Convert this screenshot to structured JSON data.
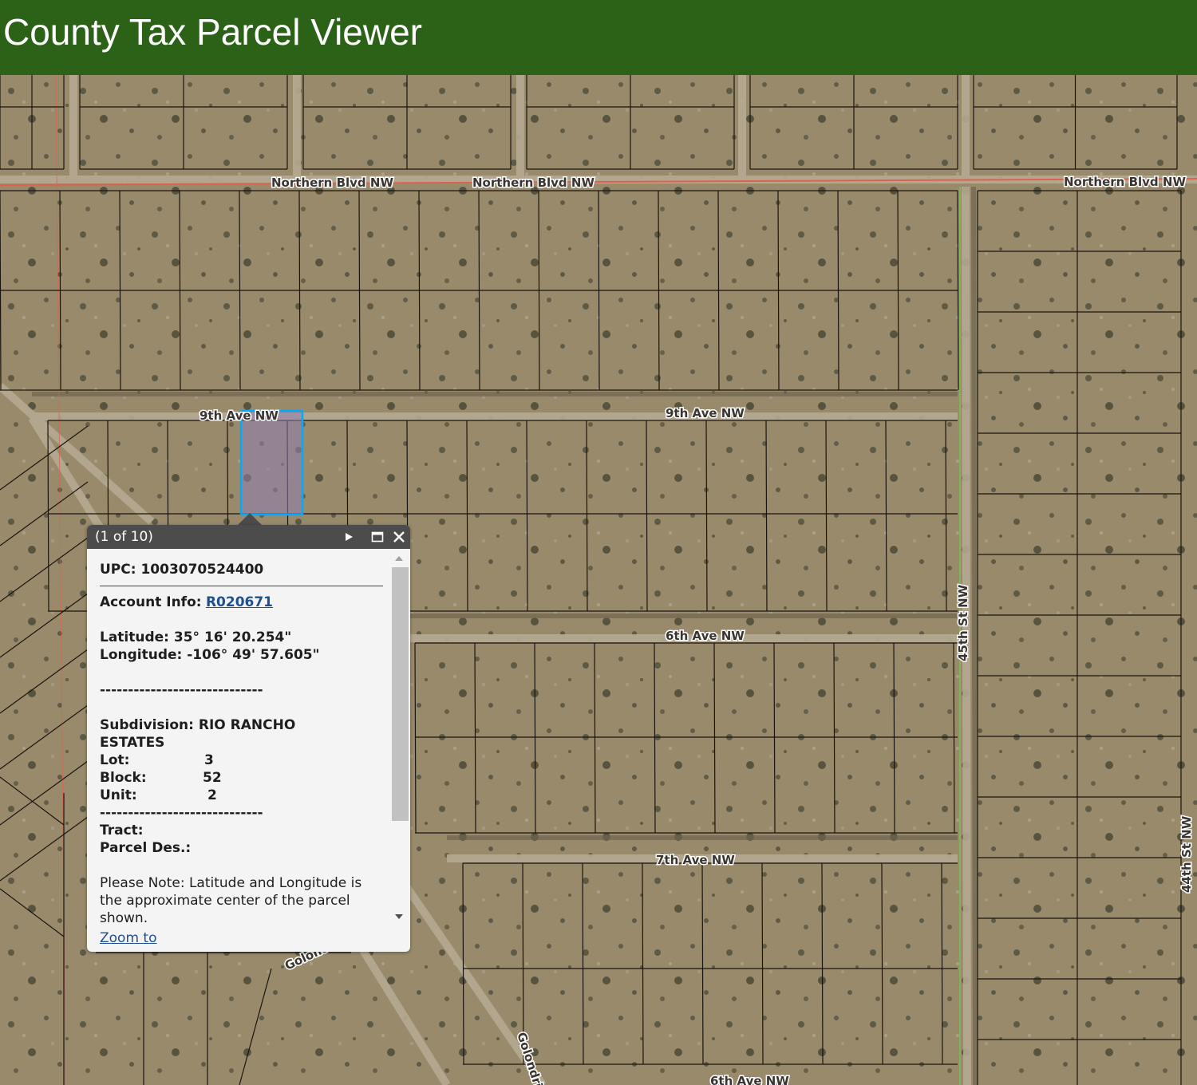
{
  "app": {
    "title": "County Tax Parcel Viewer"
  },
  "map": {
    "road_labels": [
      "Northern Blvd NW",
      "Northern Blvd NW",
      "Northern Blvd NW",
      "9th Ave NW",
      "9th Ave NW",
      "6th Ave NW",
      "7th Ave NW",
      "6th Ave NW",
      "45th St NW",
      "44th St NW",
      "Golondrina",
      "Golondrina"
    ]
  },
  "popup": {
    "counter": "(1 of 10)",
    "upc_label": "UPC: 1003070524400",
    "account_label": "Account Info:",
    "account_link": "R020671",
    "latitude": "Latitude: 35° 16' 20.254\"",
    "longitude": "Longitude: -106° 49' 57.605\"",
    "separator": "-----------------------------",
    "subdivision_line1": "Subdivision: RIO RANCHO",
    "subdivision_line2": "ESTATES",
    "lot_label": "Lot:",
    "lot_value": "3",
    "block_label": "Block:",
    "block_value": "52",
    "unit_label": "Unit:",
    "unit_value": "2",
    "tract_label": "Tract:",
    "parcel_des_label": "Parcel Des.:",
    "note_line1": "Please Note: Latitude and Longitude is",
    "note_line2": "the approximate center of the parcel",
    "note_line3": "shown.",
    "zoom_link": "Zoom to",
    "next_icon": "play-next-icon",
    "maximize_icon": "maximize-icon",
    "close_icon": "close-icon"
  },
  "colors": {
    "header": "#2c6218",
    "parcel_line": "#1a1410",
    "selected_parcel": "#00aaff",
    "arterial_line": "#e0604e",
    "popup_titlebar": "#4c4c4c",
    "link": "#1f4f8f"
  }
}
